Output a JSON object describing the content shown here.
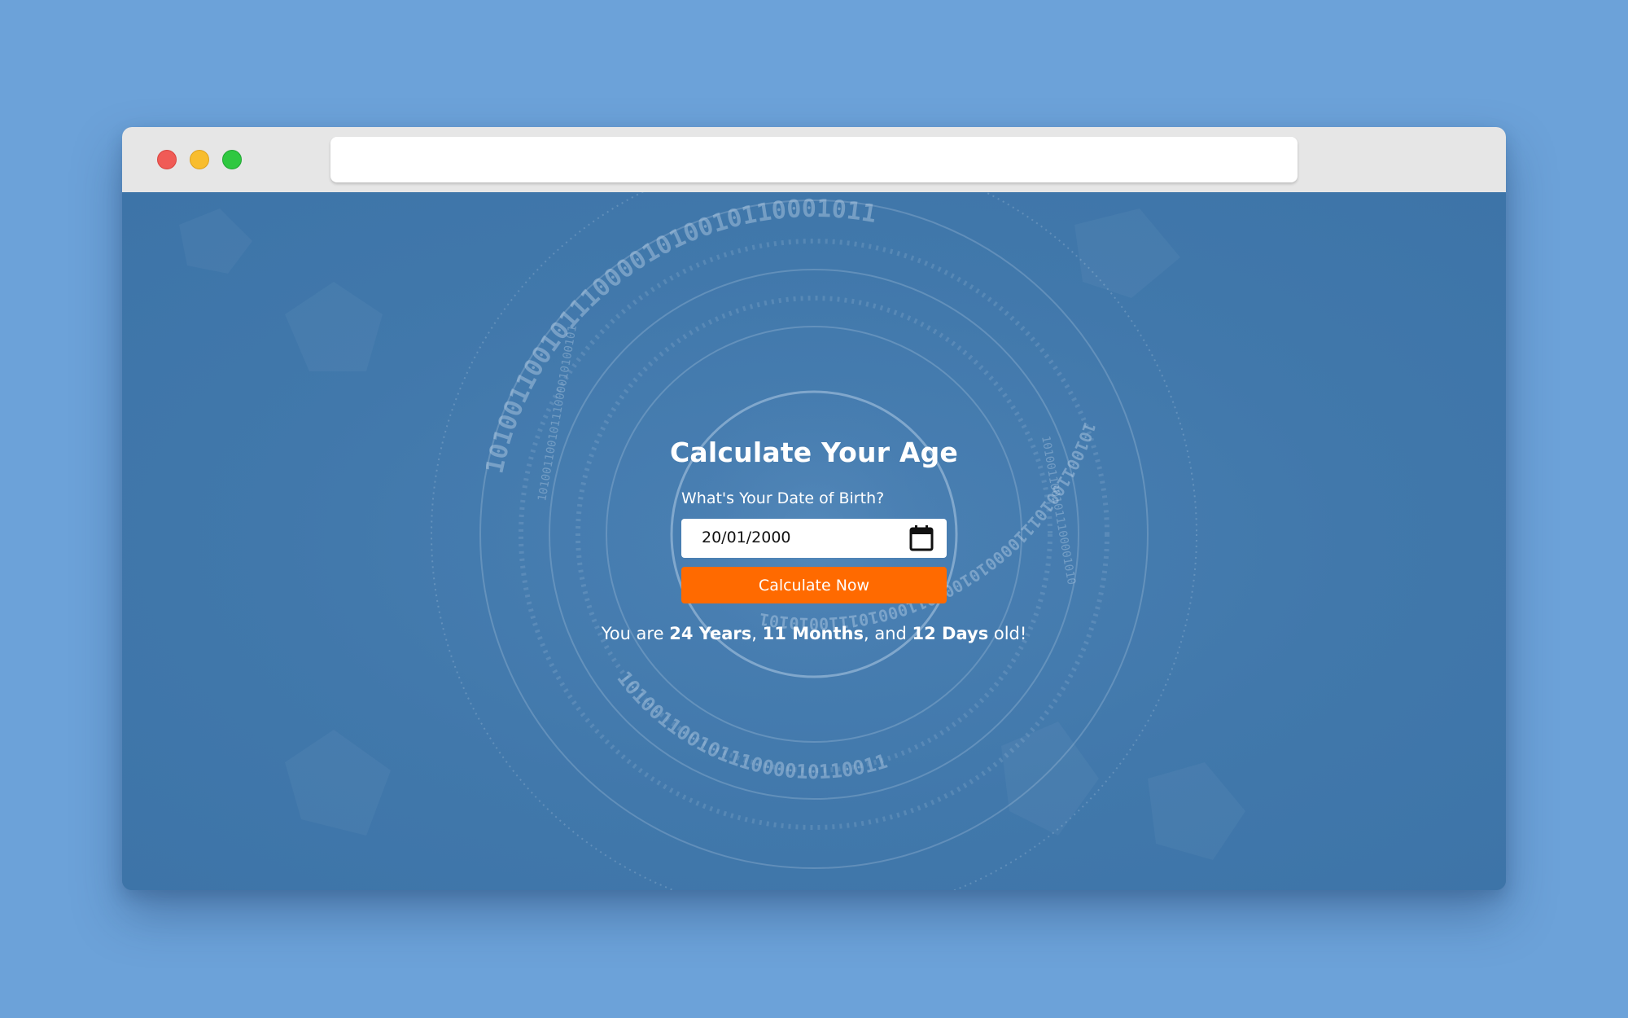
{
  "browser": {
    "address": ""
  },
  "colors": {
    "page_background": "#6ca2d9",
    "content_background": "#4178ab",
    "button": "#ff6a00",
    "text": "#ffffff"
  },
  "calculator": {
    "title": "Calculate Your Age",
    "dob_label": "What's Your Date of Birth?",
    "dob_value": "20/01/2000",
    "button_label": "Calculate Now",
    "result": {
      "prefix": "You are ",
      "years": "24 Years",
      "sep1": ", ",
      "months": "11 Months",
      "sep2": ", and ",
      "days": "12 Days",
      "suffix": " old!"
    }
  },
  "icons": {
    "calendar": "calendar-icon",
    "window_close": "close-dot",
    "window_minimize": "minimize-dot",
    "window_maximize": "maximize-dot"
  }
}
